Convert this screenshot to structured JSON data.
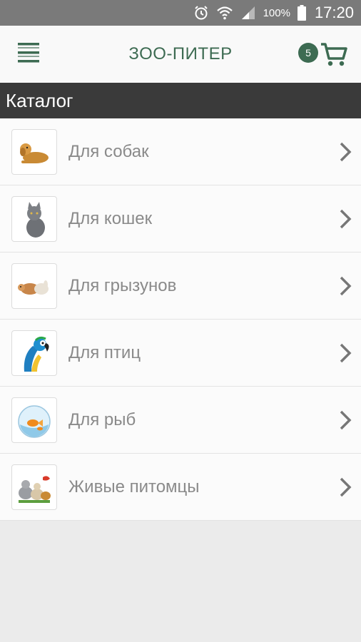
{
  "statusbar": {
    "battery": "100%",
    "time": "17:20",
    "icons": [
      "alarm-icon",
      "wifi-icon",
      "signal-icon",
      "battery-icon"
    ]
  },
  "appbar": {
    "title": "ЗОО-ПИТЕР",
    "cart_count": "5",
    "accent": "#3d6b52"
  },
  "catalog": {
    "header": "Каталог",
    "items": [
      {
        "label": "Для собак",
        "icon": "dog-image"
      },
      {
        "label": "Для кошек",
        "icon": "cat-image"
      },
      {
        "label": "Для грызунов",
        "icon": "rodent-image"
      },
      {
        "label": "Для птиц",
        "icon": "parrot-image"
      },
      {
        "label": "Для рыб",
        "icon": "fish-image"
      },
      {
        "label": "Живые питомцы",
        "icon": "pets-image"
      }
    ]
  }
}
